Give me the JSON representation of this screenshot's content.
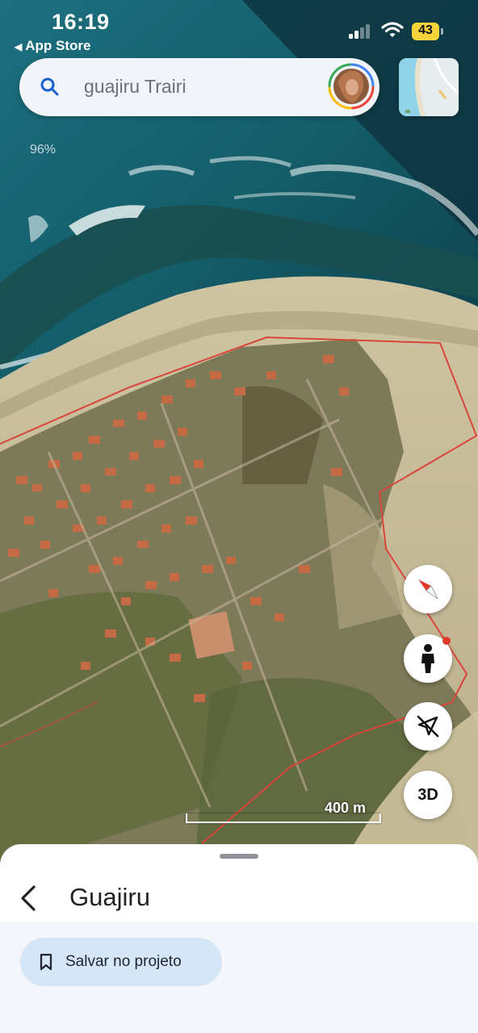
{
  "status_bar": {
    "time": "16:19",
    "back_app": "App Store",
    "battery": "43"
  },
  "search": {
    "query": "guajiru Trairi"
  },
  "map": {
    "zoom_label": "96%",
    "scale_label": "400 m",
    "boundary_color": "#d9453a"
  },
  "controls": {
    "three_d_label": "3D"
  },
  "place": {
    "name": "Guajiru",
    "save_label": "Salvar no projeto"
  }
}
